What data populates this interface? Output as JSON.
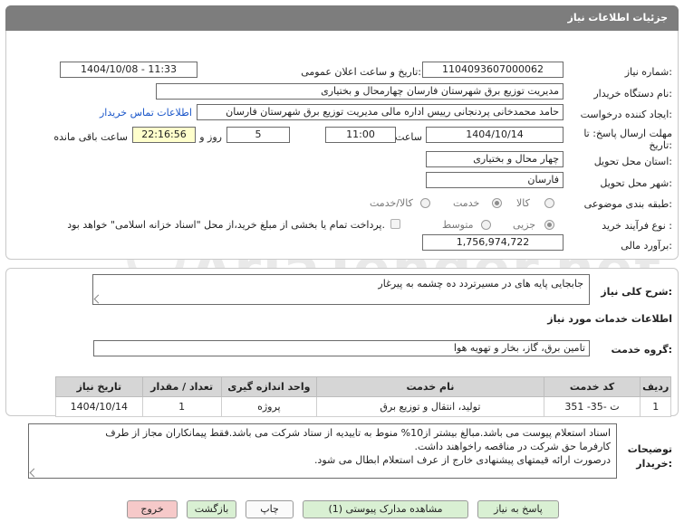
{
  "header": {
    "title": "جزئیات اطلاعات نیاز"
  },
  "details": {
    "need_number_label": "شماره نیاز:",
    "need_number": "1104093607000062",
    "announce_label": "تاریخ و ساعت اعلان عمومی:",
    "announce_value": "1404/10/08 - 11:33",
    "buyer_org_label": "نام دستگاه خریدار:",
    "buyer_org": "مدیریت توزیع برق شهرستان فارسان چهارمحال و بختیاری",
    "creator_label": "ایجاد کننده درخواست:",
    "creator": "حامد محمدخانی پردنجانی رییس اداره مالی مدیریت توزیع برق شهرستان فارسان",
    "contact_link": "اطلاعات تماس خریدار",
    "deadline_label": "مهلت ارسال پاسخ: تا تاریخ:",
    "deadline_date": "1404/10/14",
    "time_label": "ساعت",
    "deadline_time": "11:00",
    "days_value": "5",
    "days_label": "روز و",
    "remaining_time": "22:16:56",
    "remaining_label": "ساعت باقی مانده",
    "province_label": "استان محل تحویل:",
    "province": "چهار محال و بختیاری",
    "city_label": "شهر محل تحویل:",
    "city": "فارسان",
    "category_label": "طبقه بندی موضوعی:",
    "category_options": [
      "کالا",
      "خدمت",
      "کالا/خدمت"
    ],
    "process_label": "نوع فرآیند خرید :",
    "process_options": [
      "جزیی",
      "متوسط"
    ],
    "payment_note": "پرداخت تمام یا بخشی از مبلغ خرید،از محل \"اسناد خزانه اسلامی\" خواهد بود.",
    "estimate_label": "برآورد مالی:",
    "estimate": "1,756,974,722"
  },
  "summary": {
    "label": "شرح کلی نیاز:",
    "value": "جابجایی پایه های در مسیرتردد ده چشمه به پیرغار"
  },
  "services": {
    "section_title": "اطلاعات خدمات مورد نیاز",
    "group_label": "گروه خدمت:",
    "group_value": "تامین برق، گاز، بخار و تهویه هوا",
    "columns": [
      "ردیف",
      "کد خدمت",
      "نام خدمت",
      "واحد اندازه گیری",
      "تعداد / مقدار",
      "تاریخ نیاز"
    ],
    "rows": [
      [
        "1",
        "ت -35- 351",
        "تولید، انتقال و توزیع برق",
        "پروژه",
        "1",
        "1404/10/14"
      ]
    ]
  },
  "notes": {
    "label": "توضیحات خریدار:",
    "lines": [
      "اسناد استعلام پیوست می باشد.مبالغ بیشتر از10% منوط به تاییدیه از ستاد شرکت می باشد.فقط پیمانکاران مجاز از طرف",
      "کارفرما حق شرکت در مناقصه راخواهند داشت.",
      "درصورت ارائه قیمتهای پیشنهادی خارج از عرف استعلام ابطال می شود."
    ]
  },
  "buttons": {
    "reply": "پاسخ به نیاز",
    "attachments": "مشاهده مدارک پیوستی (1)",
    "print": "چاپ",
    "back": "بازگشت",
    "exit": "خروج"
  },
  "watermark": {
    "text": "AriaTender.net"
  },
  "colors": {
    "header": "#7d7d7d",
    "link": "#1a56c9",
    "remaining_bg": "#ffffcc",
    "green_btn": "#d9f0d3",
    "pink_btn": "#f6c9c9"
  }
}
